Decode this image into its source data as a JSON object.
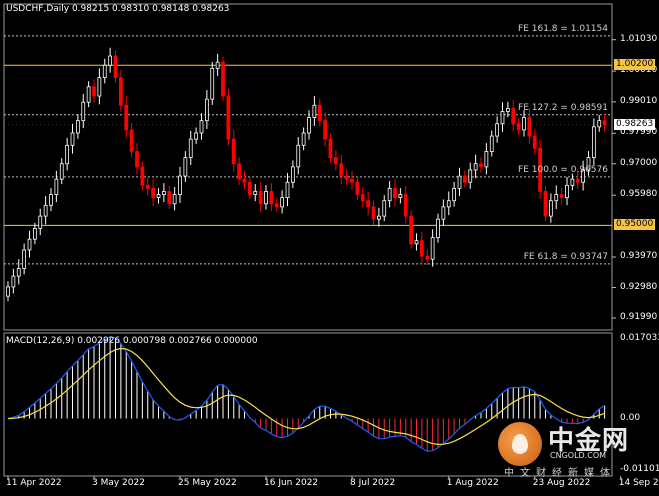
{
  "main_pane": {
    "title": "USDCHF,Daily  0.98215 0.98310 0.98148 0.98263"
  },
  "price_axis": {
    "ticks": [
      "1.01030",
      "1.00010",
      "0.99010",
      "0.97990",
      "0.97000",
      "0.95980",
      "0.93970",
      "0.92980",
      "0.91990"
    ],
    "tick_values": [
      1.0103,
      1.0001,
      0.9901,
      0.9799,
      0.97,
      0.9598,
      0.9397,
      0.9298,
      0.9199
    ],
    "current_price": "0.98263",
    "current_value": 0.98263
  },
  "levels": {
    "horizontal": [
      {
        "label": "1.00200",
        "value": 1.002,
        "color": "#f5c542"
      },
      {
        "label": "0.95000",
        "value": 0.95,
        "color": "#f5c542"
      }
    ],
    "fibonacci": [
      {
        "label": "FE 161.8 = 1.01154",
        "value": 1.01154
      },
      {
        "label": "FE 127.2 = 0.98591",
        "value": 0.98591
      },
      {
        "label": "FE 100.0 = 0.96576",
        "value": 0.96576
      },
      {
        "label": "FE 61.8 = 0.93747",
        "value": 0.93747
      }
    ]
  },
  "macd_pane": {
    "title": "MACD(12,26,9) 0.002926 0.000798 0.002766 0.000000",
    "ticks": [
      "0.017033",
      "0.00",
      "-0.011018"
    ],
    "tick_values": [
      0.017033,
      0.0,
      -0.011018
    ]
  },
  "date_axis": {
    "labels": [
      "11 Apr 2022",
      "3 May 2022",
      "25 May 2022",
      "16 Jun 2022",
      "8 Jul 2022",
      "1 Aug 2022",
      "23 Aug 2022",
      "14 Sep 2022"
    ],
    "label_bars": [
      0,
      16,
      32,
      48,
      64,
      82,
      98,
      114
    ]
  },
  "colors": {
    "bull": "#ffffff",
    "bear": "#ff0000",
    "macd_line": "#1a5cff",
    "signal_line": "#f5e050",
    "histogram_pos": "#ffffff",
    "histogram_neg": "#ff2a2a",
    "level_line": "#f5c542",
    "fibo_line": "#bfbfbf"
  },
  "chart_data": {
    "type": "candlestick",
    "symbol": "USDCHF",
    "timeframe": "Daily",
    "closes": [
      0.93,
      0.9335,
      0.936,
      0.942,
      0.9455,
      0.949,
      0.953,
      0.9565,
      0.96,
      0.965,
      0.97,
      0.976,
      0.98,
      0.984,
      0.99,
      0.995,
      0.992,
      0.998,
      1.002,
      1.005,
      0.998,
      0.989,
      0.981,
      0.974,
      0.969,
      0.963,
      0.962,
      0.959,
      0.96,
      0.961,
      0.957,
      0.96,
      0.966,
      0.972,
      0.978,
      0.98,
      0.984,
      0.991,
      1.001,
      1.003,
      0.992,
      0.978,
      0.97,
      0.965,
      0.964,
      0.96,
      0.961,
      0.957,
      0.961,
      0.957,
      0.956,
      0.959,
      0.964,
      0.969,
      0.976,
      0.98,
      0.985,
      0.989,
      0.984,
      0.978,
      0.972,
      0.97,
      0.966,
      0.965,
      0.964,
      0.96,
      0.958,
      0.956,
      0.952,
      0.953,
      0.958,
      0.962,
      0.959,
      0.96,
      0.953,
      0.944,
      0.945,
      0.94,
      0.939,
      0.946,
      0.952,
      0.956,
      0.958,
      0.962,
      0.966,
      0.964,
      0.968,
      0.97,
      0.969,
      0.974,
      0.979,
      0.983,
      0.987,
      0.988,
      0.983,
      0.981,
      0.985,
      0.979,
      0.975,
      0.961,
      0.953,
      0.958,
      0.96,
      0.959,
      0.963,
      0.965,
      0.964,
      0.968,
      0.972,
      0.982,
      0.984,
      0.9826
    ]
  }
}
